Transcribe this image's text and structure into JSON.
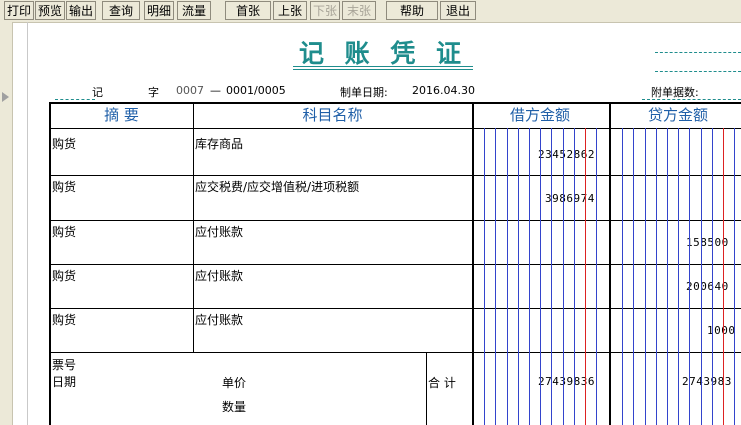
{
  "toolbar": {
    "print": "打印",
    "preview": "预览",
    "export": "输出",
    "query": "查询",
    "detail": "明细",
    "flow": "流量",
    "first": "首张",
    "prev": "上张",
    "next": "下张",
    "last": "末张",
    "help": "帮助",
    "exit": "退出"
  },
  "voucher": {
    "title": "记 账 凭 证",
    "word_prefix": "记",
    "word_suffix": "字",
    "voucher_no": "0007",
    "sep": "—",
    "page_no": "0001/0005",
    "date_label": "制单日期:",
    "date": "2016.04.30",
    "attachments_label": "附单据数:"
  },
  "headers": {
    "summary": "摘 要",
    "account": "科目名称",
    "debit": "借方金额",
    "credit": "贷方金额"
  },
  "rows": [
    {
      "summary": "购货",
      "account": "库存商品",
      "debit": "23452862",
      "credit": ""
    },
    {
      "summary": "购货",
      "account": "应交税费/应交增值税/进项税额",
      "debit": "3986974",
      "credit": ""
    },
    {
      "summary": "购货",
      "account": "应付账款",
      "debit": "",
      "credit": "158500"
    },
    {
      "summary": "购货",
      "account": "应付账款",
      "debit": "",
      "credit": "200640"
    },
    {
      "summary": "购货",
      "account": "应付账款",
      "debit": "",
      "credit": "1000"
    }
  ],
  "footer": {
    "ticket_label": "票号",
    "date_label": "日期",
    "unit_price_label": "单价",
    "quantity_label": "数量",
    "total_label": "合 计",
    "debit_total": "27439836",
    "credit_total": "2743983"
  },
  "colors": {
    "title": "#1f8d8d",
    "header_text": "#1f5fa8",
    "grid_blue": "#3344cc",
    "grid_red": "#dd2222"
  }
}
